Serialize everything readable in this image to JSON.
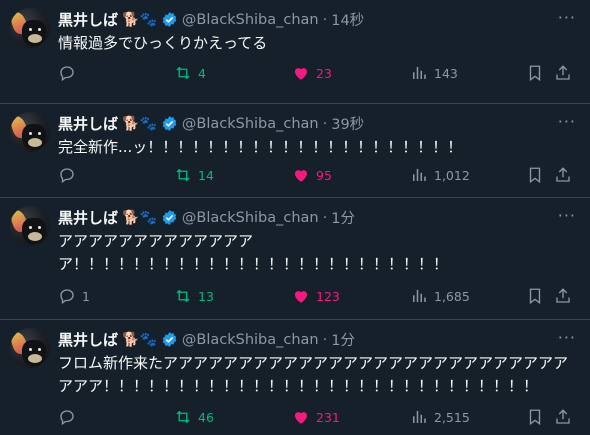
{
  "tweets": [
    {
      "name": "黒井しば",
      "name_emoji": "🐕🐾",
      "handle": "@BlackShiba_chan",
      "dot": "·",
      "time": "14秒",
      "text": "情報過多でひっくりかえってる",
      "replies": "",
      "retweets": "4",
      "likes": "23",
      "views": "143"
    },
    {
      "name": "黒井しば",
      "name_emoji": "🐕🐾",
      "handle": "@BlackShiba_chan",
      "dot": "·",
      "time": "39秒",
      "text": "完全新作...ッ！！！！！！！！！！！！！！！！！！！！！",
      "replies": "",
      "retweets": "14",
      "likes": "95",
      "views": "1,012"
    },
    {
      "name": "黒井しば",
      "name_emoji": "🐕🐾",
      "handle": "@BlackShiba_chan",
      "dot": "·",
      "time": "1分",
      "text": "アアアアアアアアアアアアアア！！！！！！！！！！！！！！！！！！！！！！！！！",
      "replies": "1",
      "retweets": "13",
      "likes": "123",
      "views": "1,685"
    },
    {
      "name": "黒井しば",
      "name_emoji": "🐕🐾",
      "handle": "@BlackShiba_chan",
      "dot": "·",
      "time": "1分",
      "text": "フロム新作来たアアアアアアアアアアアアアアアアアアアアアアアアアアアアアア！！！！！！！！！！！！！！！！！！！！！！！！！！！！！",
      "replies": "",
      "retweets": "46",
      "likes": "231",
      "views": "2,515"
    }
  ],
  "icons": {
    "reply": "reply-icon",
    "retweet": "retweet-icon",
    "like": "heart-icon",
    "views": "views-icon",
    "bookmark": "bookmark-icon",
    "share": "share-icon",
    "verified": "verified-badge-icon",
    "more": "more-icon"
  },
  "colors": {
    "background": "#15202b",
    "muted": "#8b98a5",
    "retweet": "#00ba7c",
    "like": "#f91880",
    "verified": "#1d9bf0"
  }
}
